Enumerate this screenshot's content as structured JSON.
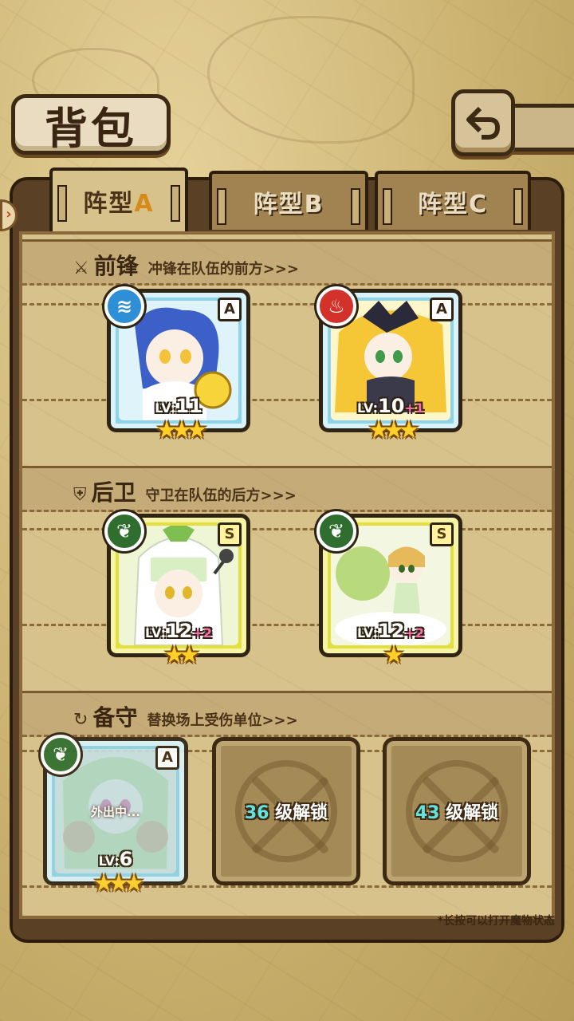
{
  "header": {
    "title": "背包",
    "back_icon": "back-arrow-icon"
  },
  "tabs": [
    {
      "label_main": "阵型",
      "label_letter": "A",
      "active": true
    },
    {
      "label_main": "阵型",
      "label_letter": "B",
      "active": false
    },
    {
      "label_main": "阵型",
      "label_letter": "C",
      "active": false
    }
  ],
  "sections": {
    "vanguard": {
      "icon": "sword-icon",
      "title": "前锋",
      "desc": "冲锋在队伍的前方>>>"
    },
    "rearguard": {
      "icon": "shield-icon",
      "title": "后卫",
      "desc": "守卫在队伍的后方>>>"
    },
    "reserve": {
      "icon": "refresh-icon",
      "title": "备守",
      "desc": "替换场上受伤单位>>>"
    }
  },
  "units": {
    "vanguard_1": {
      "rank": "A",
      "element": "water",
      "level_prefix": "LV:",
      "level": "11",
      "bonus": "",
      "stars": "★★★"
    },
    "vanguard_2": {
      "rank": "A",
      "element": "fire",
      "level_prefix": "LV:",
      "level": "10",
      "bonus": "+1",
      "stars": "★★★"
    },
    "rearguard_1": {
      "rank": "S",
      "element": "leaf",
      "level_prefix": "LV:",
      "level": "12",
      "bonus": "+2",
      "stars": "★★"
    },
    "rearguard_2": {
      "rank": "S",
      "element": "leaf",
      "level_prefix": "LV:",
      "level": "12",
      "bonus": "+2",
      "stars": "★"
    },
    "reserve_1": {
      "rank": "A",
      "element": "leaf",
      "level_prefix": "LV:",
      "level": "6",
      "bonus": "",
      "stars": "★★★",
      "status": "外出中..."
    }
  },
  "locked_slots": [
    {
      "level": "36",
      "text": " 级解锁"
    },
    {
      "level": "43",
      "text": " 级解锁"
    }
  ],
  "footnote": "*长按可以打开魔物状态",
  "colors": {
    "rank_A": "#8fd3ea",
    "rank_S": "#e3df40",
    "water": "#2f8fd6",
    "fire": "#d3322a",
    "leaf": "#2f6e2f",
    "bonus": "#ff6fb0",
    "unlock_level": "#63e3e0"
  }
}
